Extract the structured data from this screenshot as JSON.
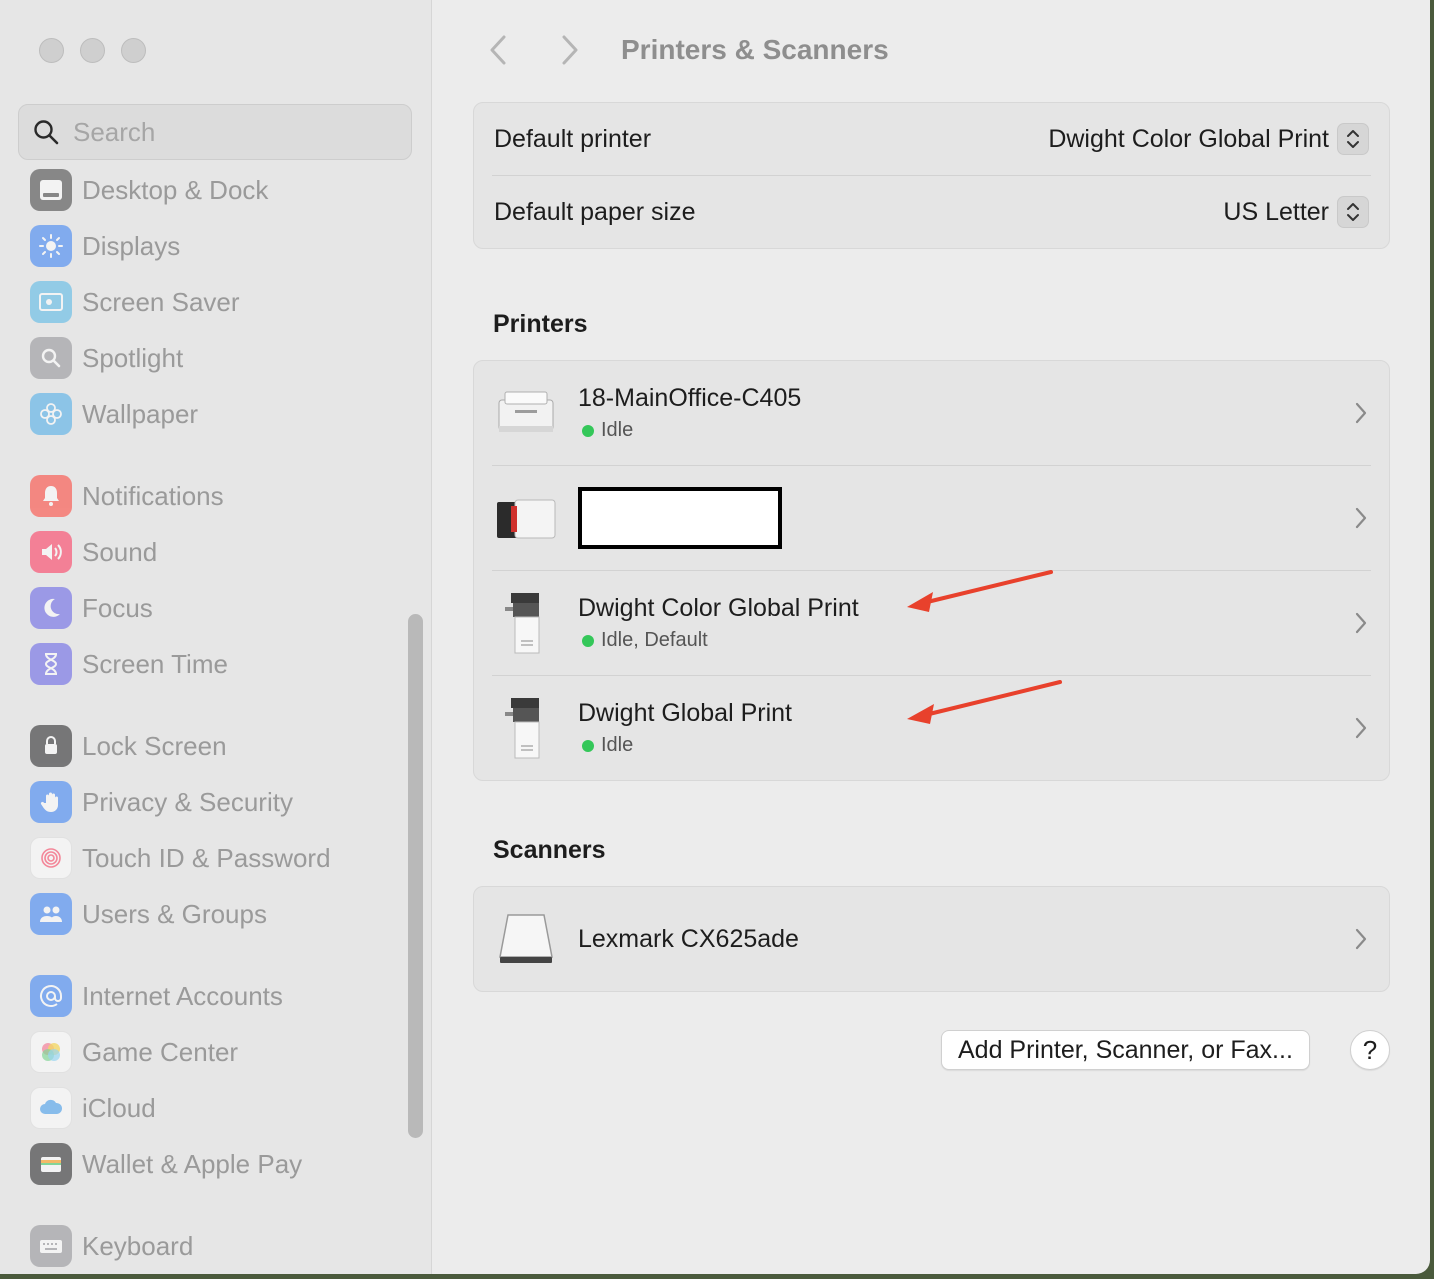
{
  "sidebar": {
    "search_placeholder": "Search",
    "items": [
      {
        "label": "Desktop & Dock",
        "icon": "dock-icon",
        "color": "#3a3a3a"
      },
      {
        "label": "Displays",
        "icon": "sun-icon",
        "color": "#2f7cf6"
      },
      {
        "label": "Screen Saver",
        "icon": "screen-saver-icon",
        "color": "#4fb5e6"
      },
      {
        "label": "Spotlight",
        "icon": "magnifier-icon",
        "color": "#8e8e93"
      },
      {
        "label": "Wallpaper",
        "icon": "flower-icon",
        "color": "#44a9e8"
      },
      {
        "label": "Notifications",
        "icon": "bell-icon",
        "color": "#ff3b30"
      },
      {
        "label": "Sound",
        "icon": "speaker-icon",
        "color": "#ff2d55"
      },
      {
        "label": "Focus",
        "icon": "moon-icon",
        "color": "#5e5ce6"
      },
      {
        "label": "Screen Time",
        "icon": "hourglass-icon",
        "color": "#5e5ce6"
      },
      {
        "label": "Lock Screen",
        "icon": "lock-icon",
        "color": "#1c1c1e"
      },
      {
        "label": "Privacy & Security",
        "icon": "hand-icon",
        "color": "#2f7cf6"
      },
      {
        "label": "Touch ID & Password",
        "icon": "fingerprint-icon",
        "color": "#ffffff"
      },
      {
        "label": "Users & Groups",
        "icon": "users-icon",
        "color": "#2f7cf6"
      },
      {
        "label": "Internet Accounts",
        "icon": "at-icon",
        "color": "#2f7cf6"
      },
      {
        "label": "Game Center",
        "icon": "game-center-icon",
        "color": "#ffffff"
      },
      {
        "label": "iCloud",
        "icon": "cloud-icon",
        "color": "#ffffff"
      },
      {
        "label": "Wallet & Apple Pay",
        "icon": "wallet-icon",
        "color": "#1c1c1e"
      },
      {
        "label": "Keyboard",
        "icon": "keyboard-icon",
        "color": "#8e8e93"
      }
    ]
  },
  "header": {
    "title": "Printers & Scanners"
  },
  "defaults": {
    "printer_label": "Default printer",
    "printer_value": "Dwight Color Global Print",
    "paper_label": "Default paper size",
    "paper_value": "US Letter"
  },
  "printers": {
    "heading": "Printers",
    "items": [
      {
        "name": "18-MainOffice-C405",
        "status": "Idle"
      },
      {
        "name": "",
        "status": ""
      },
      {
        "name": "Dwight Color Global Print",
        "status": "Idle, Default"
      },
      {
        "name": "Dwight Global Print",
        "status": "Idle"
      }
    ]
  },
  "scanners": {
    "heading": "Scanners",
    "items": [
      {
        "name": "Lexmark CX625ade"
      }
    ]
  },
  "actions": {
    "add_label": "Add Printer, Scanner, or Fax...",
    "help_label": "?"
  },
  "colors": {
    "annotation_arrow": "#e8412c",
    "status_idle": "#34c759"
  }
}
